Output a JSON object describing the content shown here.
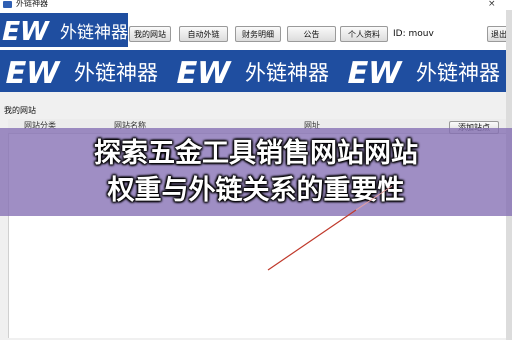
{
  "window": {
    "title": "外链神器",
    "close_glyph": "×"
  },
  "logo": {
    "badge": "EW",
    "text": "外链神器"
  },
  "toolbar": {
    "tabs": [
      {
        "label": "我的网站"
      },
      {
        "label": "自动外链"
      },
      {
        "label": "财务明细"
      },
      {
        "label": "公告"
      },
      {
        "label": "个人资料"
      }
    ],
    "user_id": "ID: mouv",
    "exit_label": "退出"
  },
  "section": {
    "title": "我的网站",
    "columns": [
      "网站分类",
      "网站名称",
      "网址"
    ],
    "add_button": "添加站点"
  },
  "overlay": {
    "line1": "探索五金工具销售网站网站",
    "line2": "权重与外链关系的重要性"
  },
  "colors": {
    "banner_blue": "#1f4ea0",
    "overlay_purple": "#846eb4",
    "accent_red": "#c0392b"
  }
}
